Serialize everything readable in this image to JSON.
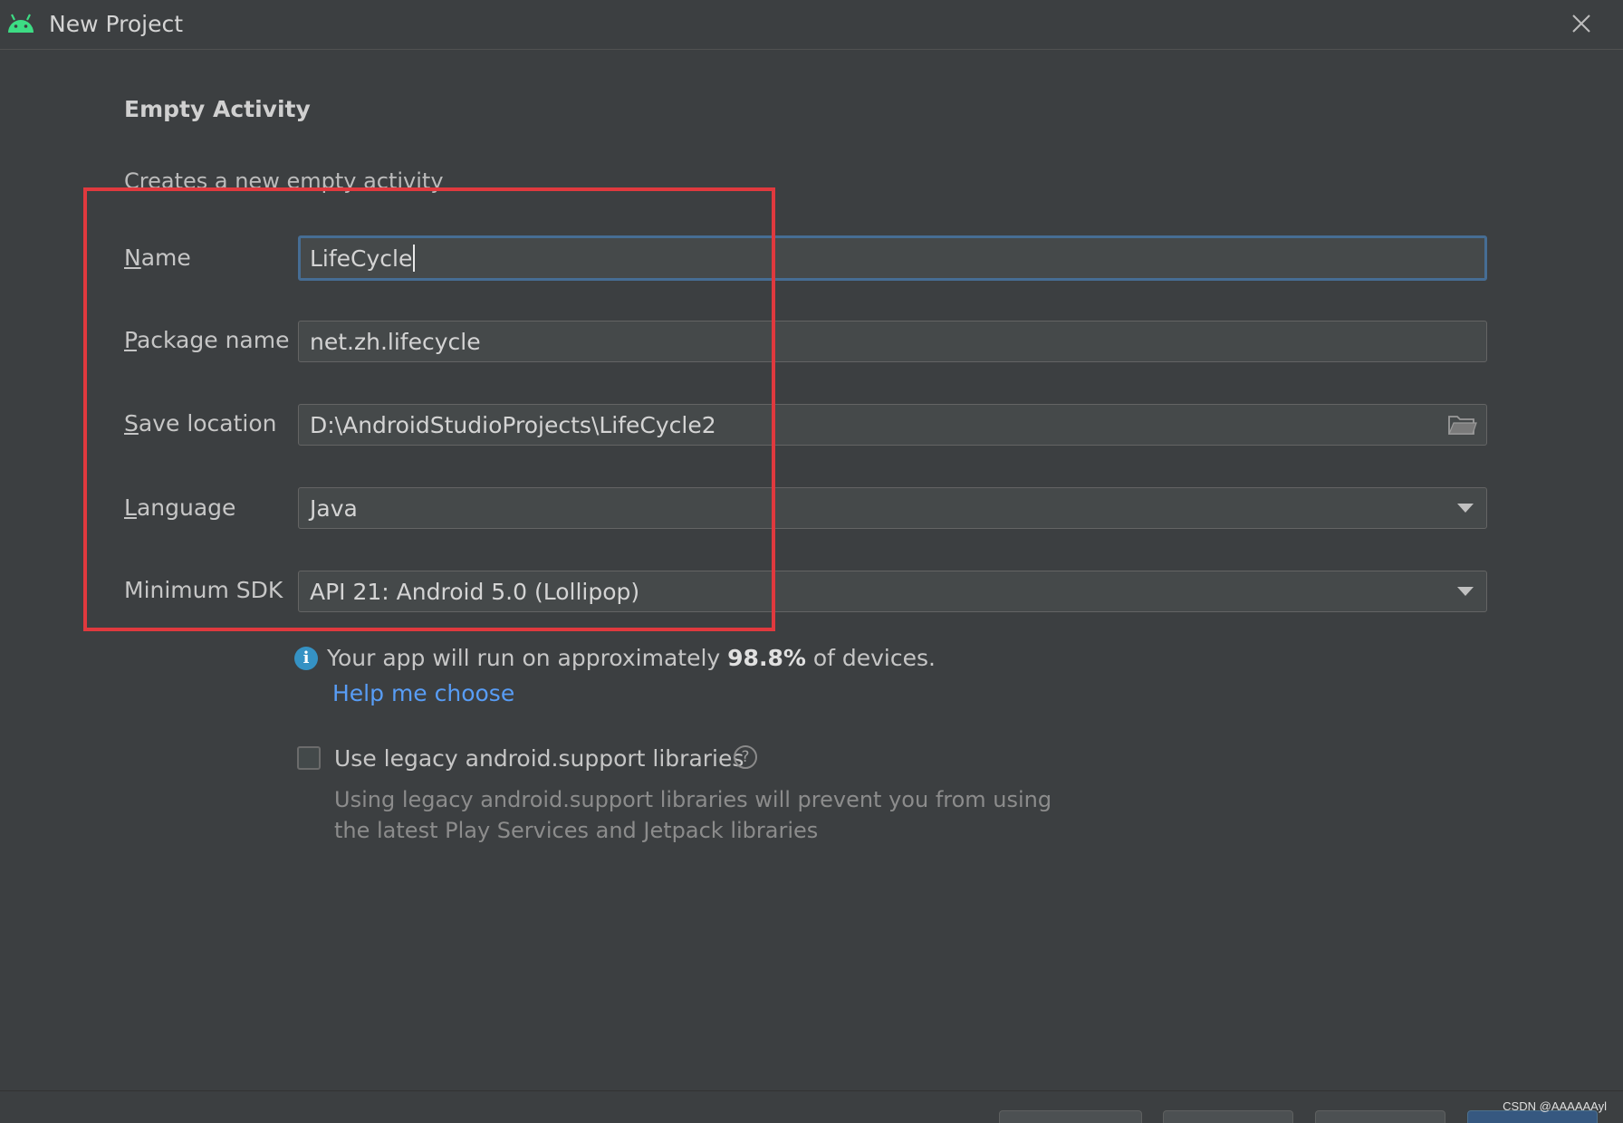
{
  "window": {
    "title": "New Project",
    "app_icon": "android-icon",
    "close_icon": "close-icon"
  },
  "template": {
    "heading": "Empty Activity",
    "description": "Creates a new empty activity"
  },
  "form": {
    "name": {
      "label_mnemonic": "N",
      "label_rest": "ame",
      "value": "LifeCycle"
    },
    "package_name": {
      "label_mnemonic": "P",
      "label_rest": "ackage name",
      "value": "net.zh.lifecycle"
    },
    "save_location": {
      "label_mnemonic": "S",
      "label_rest": "ave location",
      "value": "D:\\AndroidStudioProjects\\LifeCycle2",
      "icon": "folder-icon"
    },
    "language": {
      "label_mnemonic": "L",
      "label_rest": "anguage",
      "value": "Java"
    },
    "minimum_sdk": {
      "label": "Minimum SDK",
      "value": "API 21: Android 5.0 (Lollipop)"
    }
  },
  "info": {
    "prefix": "Your app will run on approximately ",
    "percent": "98.8%",
    "suffix": " of devices.",
    "help_link": "Help me choose",
    "icon": "info-icon"
  },
  "legacy": {
    "checked": false,
    "label": "Use legacy android.support libraries",
    "help_icon": "question-icon",
    "note_line1": "Using legacy android.support libraries will prevent you from using",
    "note_line2": "the latest Play Services and Jetpack libraries"
  },
  "watermark": "CSDN @AAAAAAyl",
  "colors": {
    "background": "#3c3f41",
    "field_bg": "#45494a",
    "focus_border": "#466d94",
    "highlight_box": "#e0393e",
    "link": "#589df6",
    "info_icon": "#3592c4",
    "android_green": "#3ddc84"
  }
}
